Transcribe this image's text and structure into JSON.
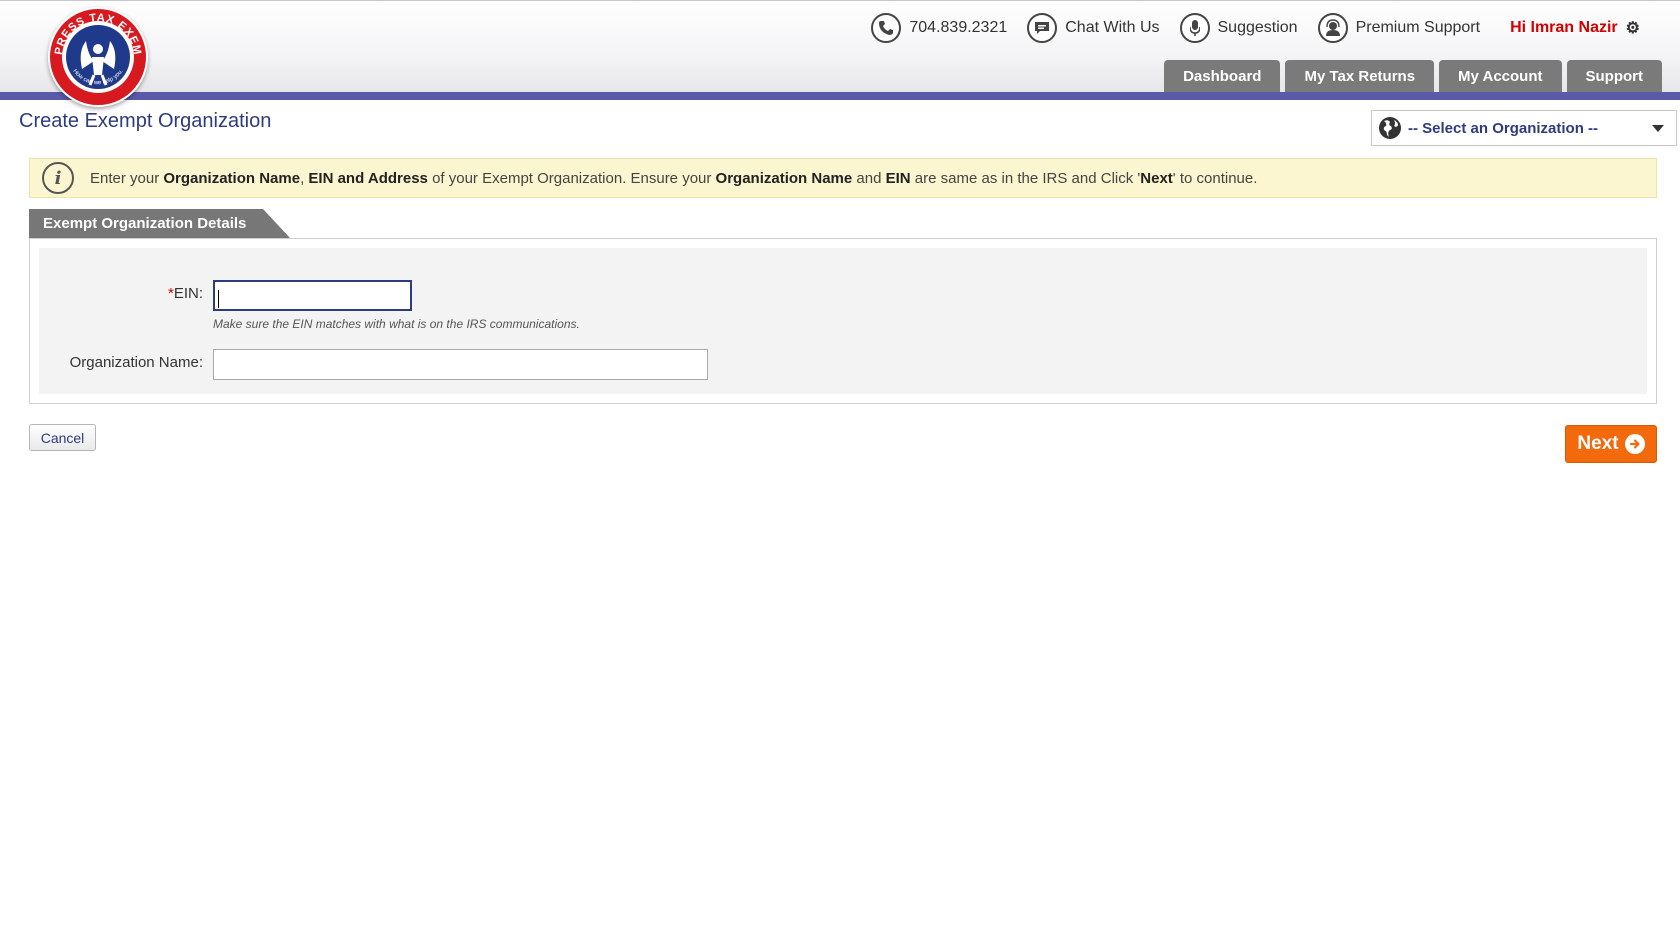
{
  "brand": {
    "logo_icon": "express-tax-exempt-logo",
    "logo_text": "EXPRESS TAX EXEMPT",
    "logo_tagline": "How can we help you.",
    "primary_color": "#2e3c7e",
    "accent_color": "#5a5aab",
    "logo_red": "#d71920"
  },
  "top_links": [
    {
      "label": "704.839.2321",
      "icon": "phone-icon"
    },
    {
      "label": "Chat With Us",
      "icon": "chat-icon"
    },
    {
      "label": "Suggestion",
      "icon": "suggestion-icon"
    },
    {
      "label": "Premium Support",
      "icon": "premium-support-icon"
    }
  ],
  "user": {
    "greeting": "Hi Imran Nazir",
    "icon": "gear-icon"
  },
  "nav_tabs": [
    {
      "label": "Dashboard"
    },
    {
      "label": "My Tax Returns"
    },
    {
      "label": "My Account"
    },
    {
      "label": "Support"
    }
  ],
  "page": {
    "title": "Create Exempt Organization"
  },
  "org_select": {
    "selected": "-- Select an Organization --",
    "icon": "globe-icon"
  },
  "info": {
    "icon": "info-icon",
    "parts": [
      {
        "text": "Enter your ",
        "bold": false
      },
      {
        "text": "Organization Name",
        "bold": true
      },
      {
        "text": ", ",
        "bold": false
      },
      {
        "text": "EIN and Address",
        "bold": true
      },
      {
        "text": " of your Exempt Organization. Ensure your ",
        "bold": false
      },
      {
        "text": "Organization Name",
        "bold": true
      },
      {
        "text": " and ",
        "bold": false
      },
      {
        "text": "EIN",
        "bold": true
      },
      {
        "text": " are same as in the IRS and Click '",
        "bold": false
      },
      {
        "text": "Next",
        "bold": true
      },
      {
        "text": "' to continue.",
        "bold": false
      }
    ]
  },
  "section": {
    "title": "Exempt Organization Details",
    "ein": {
      "required_mark": "*",
      "label": "EIN:",
      "value": "",
      "hint": "Make sure the EIN matches with what is on the IRS communications."
    },
    "org_name": {
      "label": "Organization Name:",
      "value": ""
    }
  },
  "actions": {
    "cancel": "Cancel",
    "next": "Next",
    "next_icon": "arrow-right-circle-icon"
  }
}
